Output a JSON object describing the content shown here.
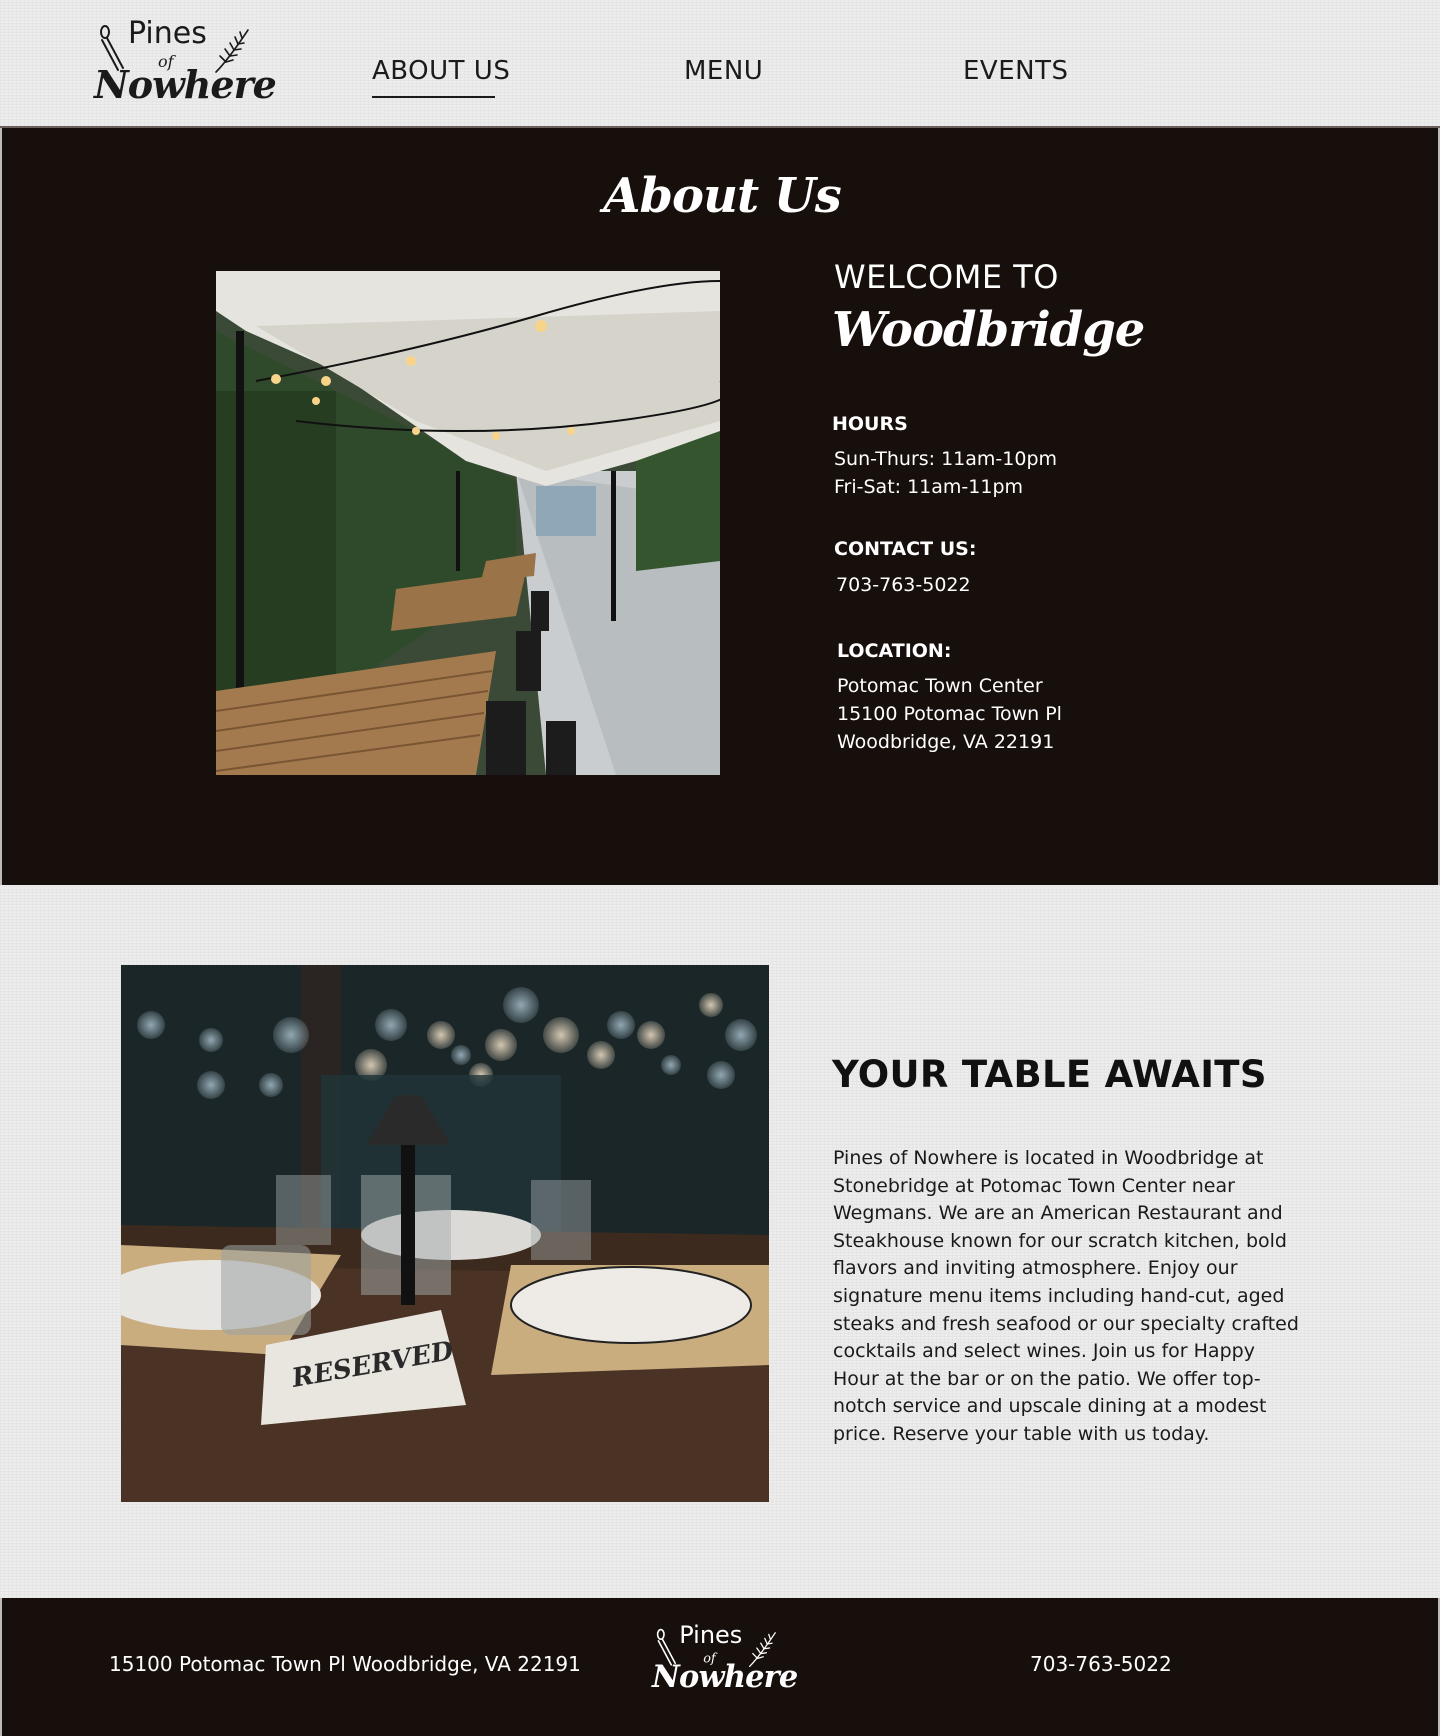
{
  "brand": {
    "name_top": "Pines",
    "name_mid": "of",
    "name_bottom": "Nowhere"
  },
  "nav": {
    "items": [
      {
        "label": "ABOUT US",
        "active": true
      },
      {
        "label": "MENU",
        "active": false
      },
      {
        "label": "EVENTS",
        "active": false
      }
    ]
  },
  "about": {
    "title": "About Us",
    "welcome": "WELCOME TO",
    "location_name": "Woodbridge",
    "hours": {
      "heading": "HOURS",
      "lines": [
        "Sun-Thurs: 11am-10pm",
        "Fri-Sat: 11am-11pm"
      ]
    },
    "contact": {
      "heading": "CONTACT US:",
      "phone": "703-763-5022"
    },
    "location": {
      "heading": "LOCATION:",
      "lines": [
        "Potomac Town Center",
        "15100 Potomac Town Pl",
        "Woodbridge, VA 22191"
      ]
    }
  },
  "table_section": {
    "heading": "YOUR TABLE AWAITS",
    "description": "Pines of Nowhere is located in Woodbridge at Stonebridge at Potomac Town Center near Wegmans. We are an American Restaurant and Steakhouse known for our scratch kitchen, bold flavors and inviting atmosphere. Enjoy our signature menu items including hand-cut, aged steaks and fresh seafood or our specialty crafted cocktails and select wines. Join us for Happy Hour at the bar or on the patio. We offer top-notch service and upscale dining at a modest price. Reserve your table with us today.",
    "sign_text": "RESERVED"
  },
  "footer": {
    "address": "15100 Potomac Town Pl Woodbridge, VA 22191",
    "phone": "703-763-5022"
  },
  "colors": {
    "dark_bg": "#170f0c",
    "light_bg": "#ececec",
    "text_dark": "#1a1a1a",
    "text_light": "#ffffff"
  }
}
